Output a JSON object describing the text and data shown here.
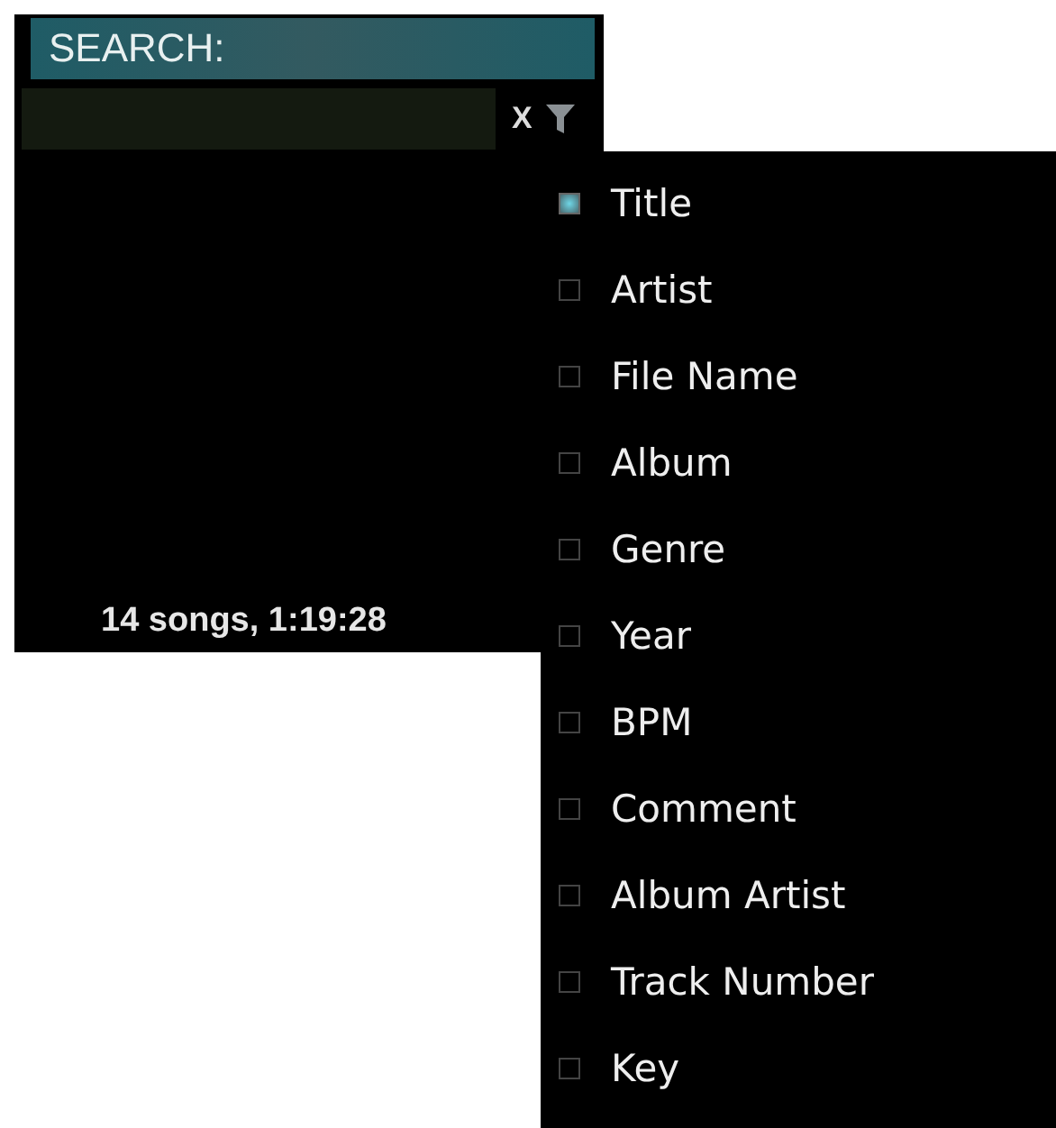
{
  "search": {
    "label": "SEARCH:",
    "clear": "X"
  },
  "status": "14 songs, 1:19:28",
  "filter_menu": [
    {
      "label": "Title",
      "checked": true
    },
    {
      "label": "Artist",
      "checked": false
    },
    {
      "label": "File Name",
      "checked": false
    },
    {
      "label": "Album",
      "checked": false
    },
    {
      "label": "Genre",
      "checked": false
    },
    {
      "label": "Year",
      "checked": false
    },
    {
      "label": "BPM",
      "checked": false
    },
    {
      "label": "Comment",
      "checked": false
    },
    {
      "label": "Album Artist",
      "checked": false
    },
    {
      "label": "Track Number",
      "checked": false
    },
    {
      "label": "Key",
      "checked": false
    }
  ]
}
